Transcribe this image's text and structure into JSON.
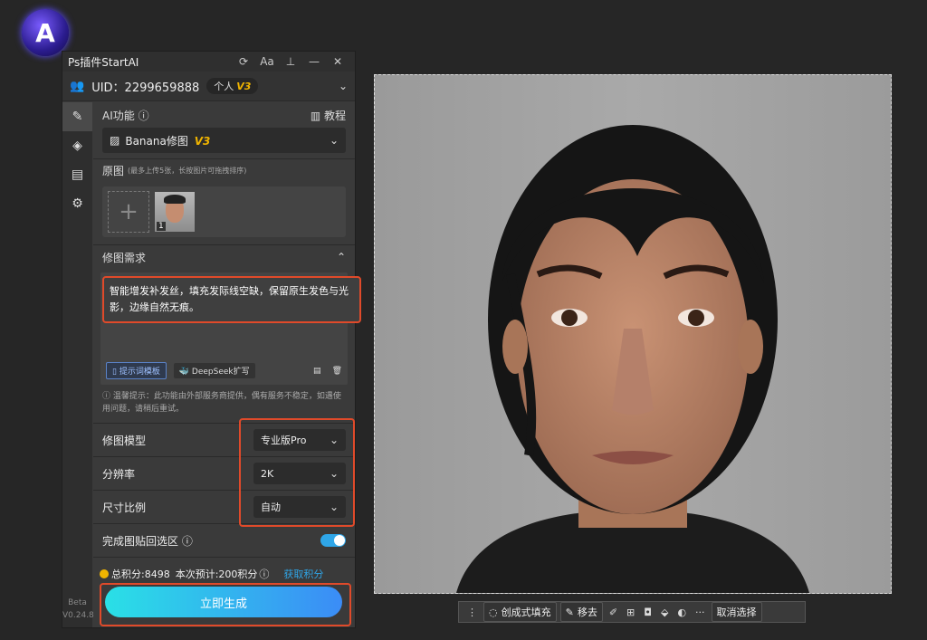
{
  "panel": {
    "title": "Ps插件StartAI",
    "uid_label": "UID：2299659888",
    "plan": "个人",
    "plan_version": "V3",
    "version_beta": "Beta",
    "version_num": "V0.24.8"
  },
  "ai": {
    "label": "AI功能",
    "tutorial": "教程",
    "function_name": "Banana修图",
    "function_version": "V3"
  },
  "source": {
    "label": "原图",
    "hint": "(最多上传5张，长按图片可拖拽排序)",
    "thumb_index": "1"
  },
  "request": {
    "label": "修图需求",
    "text": "智能增发补发丝，填充发际线空缺，保留原生发色与光影，边缘自然无痕。",
    "template_btn": "提示词模板",
    "deepseek_btn": "DeepSeek扩写",
    "tip": "温馨提示：此功能由外部服务商提供，偶有服务不稳定，如遇使用问题，请稍后重试。"
  },
  "settings": {
    "model_label": "修图模型",
    "model_value": "专业版Pro",
    "resolution_label": "分辨率",
    "resolution_value": "2K",
    "ratio_label": "尺寸比例",
    "ratio_value": "自动",
    "paste_label": "完成图贴回选区",
    "paste_on": true
  },
  "points": {
    "total": "总积分:8498",
    "estimate": "本次预计:200积分",
    "get": "获取积分"
  },
  "generate_label": "立即生成",
  "canvas_toolbar": {
    "gen_fill": "创成式填充",
    "remove": "移去",
    "deselect": "取消选择",
    "more": "···"
  },
  "colors": {
    "accent": "#2fa6e8",
    "highlight": "#e04a2a",
    "gold": "#f0b400"
  }
}
